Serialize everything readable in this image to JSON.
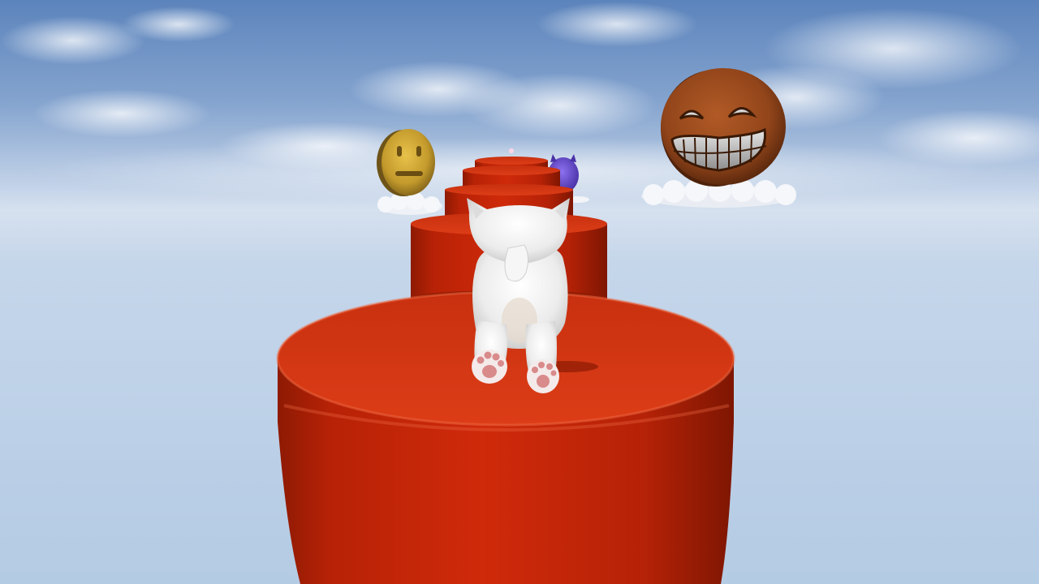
{
  "scene": {
    "type": "3d-platformer-viewport",
    "hud_text": []
  },
  "colors": {
    "sky_top": "#5e86bd",
    "sky_mid": "#c9d9ec",
    "sky_horizon": "#d4e0ee",
    "platform_red": "#c92408",
    "platform_red_dark": "#8a1602",
    "platform_top": "#d63a16",
    "cat_fur": "#eeeeee",
    "paw_pink": "#d88888",
    "coin_gold": "#c9a02e",
    "coin_rust": "#9a4a1e",
    "coin_purple": "#6e4fd8",
    "cloud_white": "#f2f4f8"
  },
  "objects": {
    "player": {
      "kind": "white-kitten",
      "pose": "crawling-away"
    },
    "coins": [
      {
        "kind": "gold-neutral-face-coin"
      },
      {
        "kind": "purple-devil-face-coin"
      },
      {
        "kind": "rusty-grinning-face-coin"
      }
    ],
    "platforms": [
      {
        "kind": "red-cylinder-near"
      },
      {
        "kind": "red-cylinder-mid"
      },
      {
        "kind": "red-cylinder-step-1"
      },
      {
        "kind": "red-cylinder-step-2"
      },
      {
        "kind": "red-cylinder-step-3"
      }
    ]
  }
}
